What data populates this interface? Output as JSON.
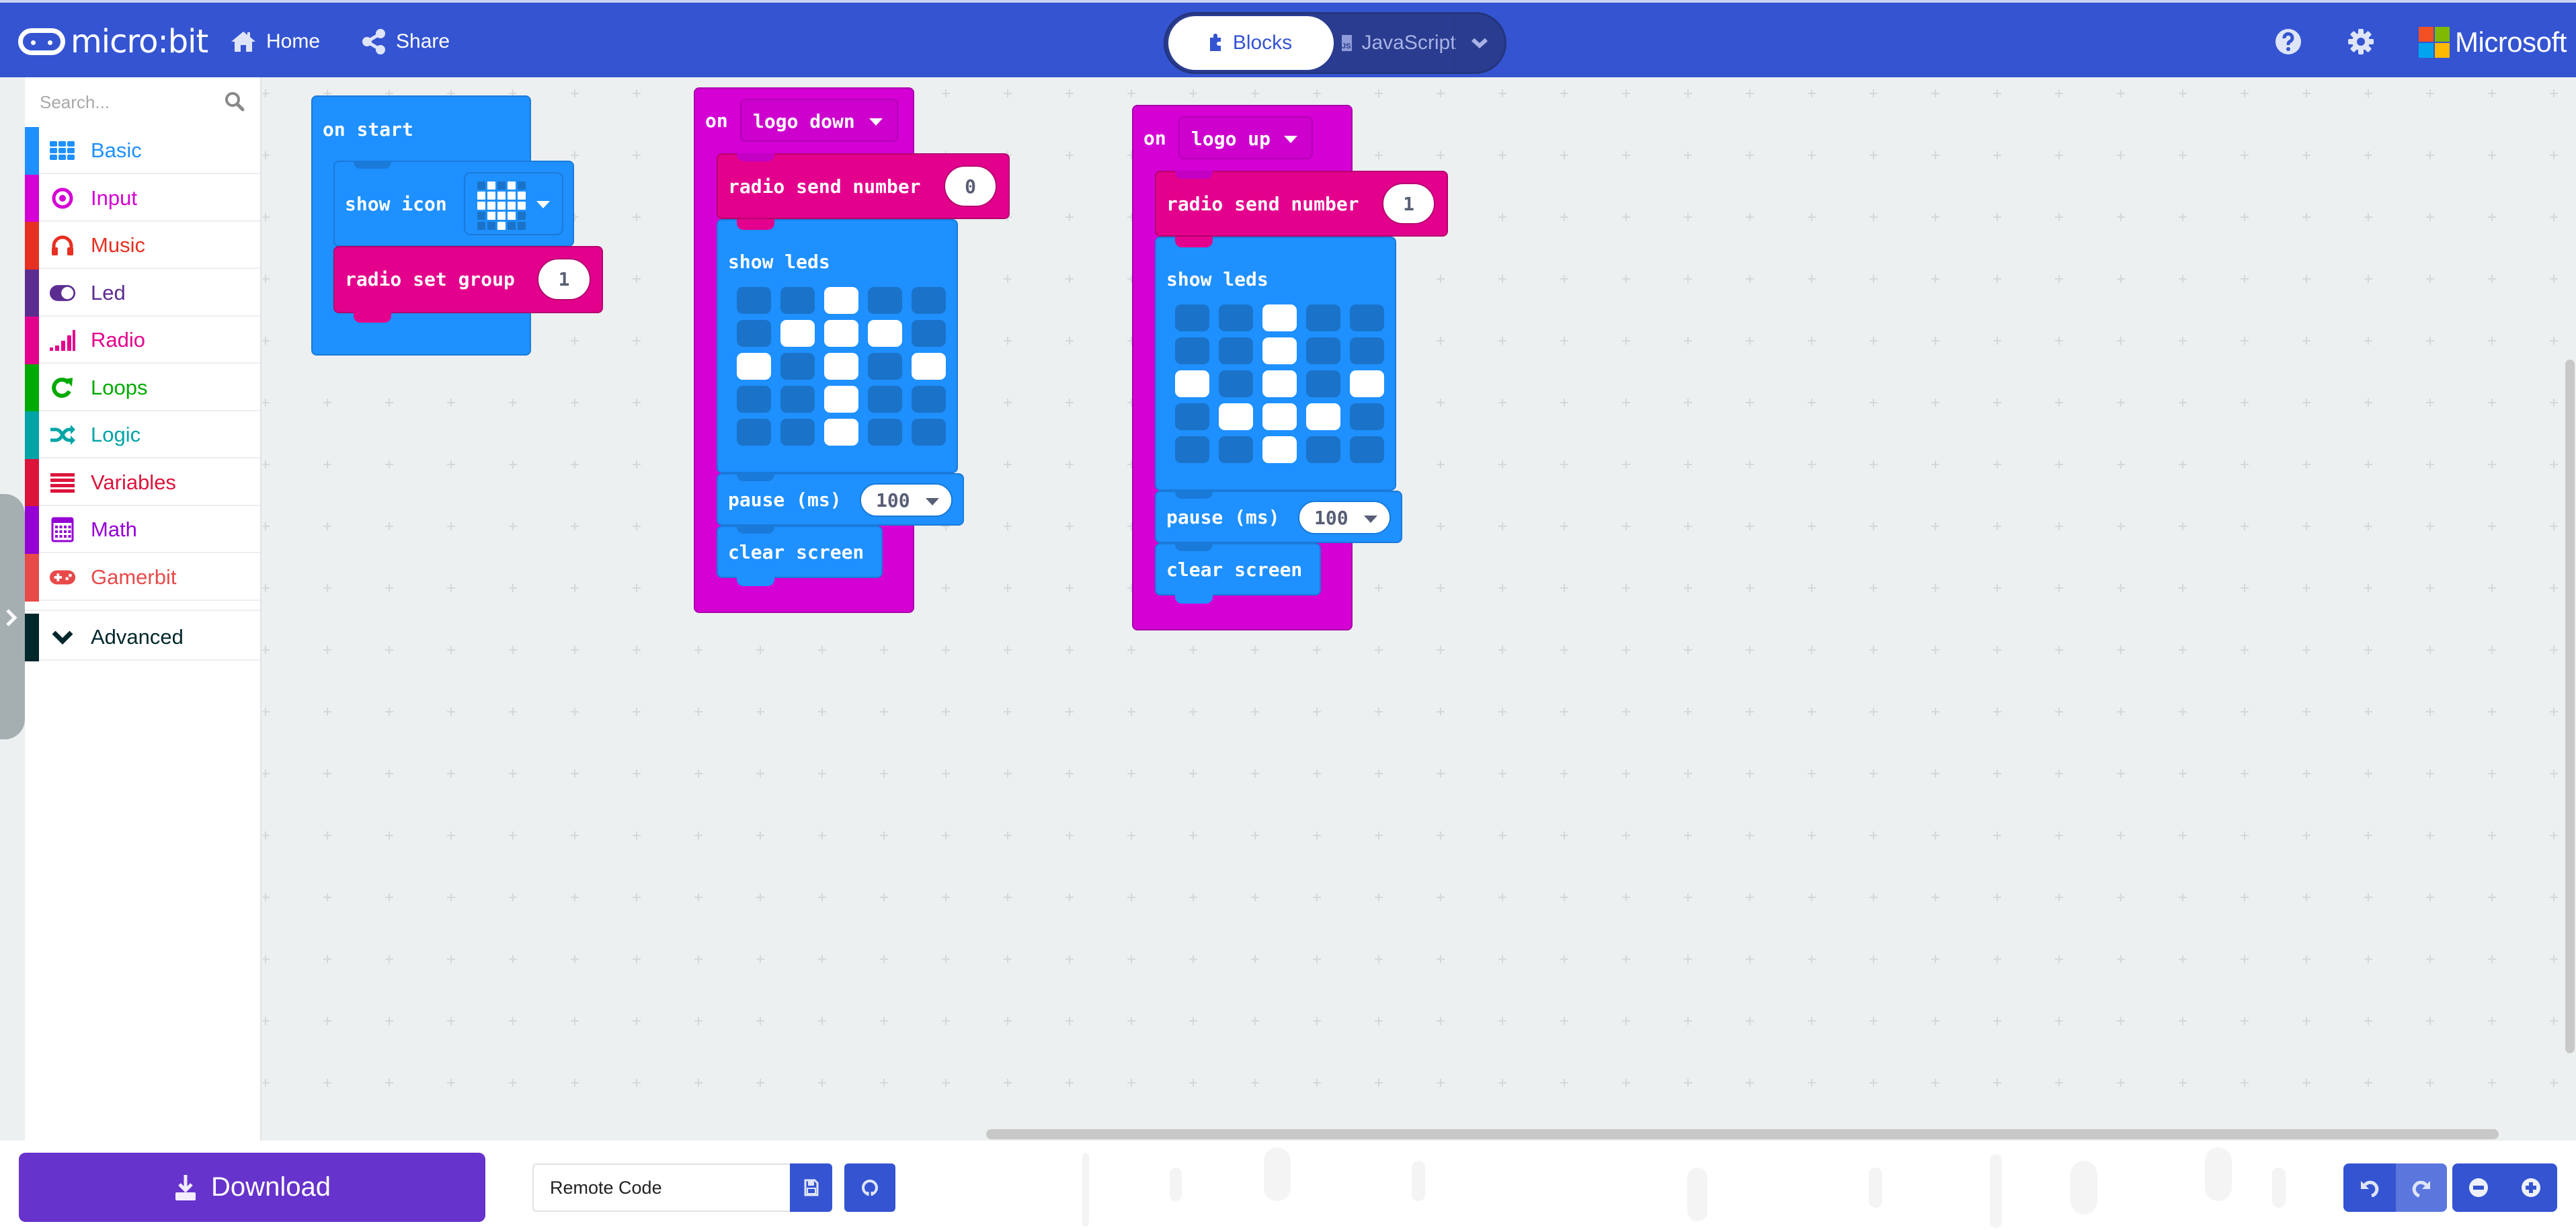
{
  "header": {
    "brand": "micro:bit",
    "home_label": "Home",
    "share_label": "Share",
    "editor_toggle": {
      "blocks_label": "Blocks",
      "javascript_label": "JavaScript",
      "javascript_badge": "JS",
      "active": "Blocks"
    },
    "help_icon": "question-circle-icon",
    "settings_icon": "gear-icon",
    "microsoft_label": "Microsoft",
    "microsoft_colors": [
      "#f25022",
      "#7fba00",
      "#00a4ef",
      "#ffb900"
    ]
  },
  "colors": {
    "header_bg": "#3454d1",
    "download_bg": "#6633cc",
    "basic": "#1e90ff",
    "radio": "#e3008c",
    "input": "#d400d4"
  },
  "sidebar": {
    "search_placeholder": "Search...",
    "categories": [
      {
        "label": "Basic",
        "icon": "grid-icon",
        "color": "#1e90ff"
      },
      {
        "label": "Input",
        "icon": "target-icon",
        "color": "#d400d4"
      },
      {
        "label": "Music",
        "icon": "headphones-icon",
        "color": "#e63022"
      },
      {
        "label": "Led",
        "icon": "toggle-icon",
        "color": "#5c2d91"
      },
      {
        "label": "Radio",
        "icon": "signal-bars-icon",
        "color": "#e3008c"
      },
      {
        "label": "Loops",
        "icon": "refresh-icon",
        "color": "#00aa00"
      },
      {
        "label": "Logic",
        "icon": "shuffle-icon",
        "color": "#00a4a6"
      },
      {
        "label": "Variables",
        "icon": "list-icon",
        "color": "#dc143c"
      },
      {
        "label": "Math",
        "icon": "calculator-icon",
        "color": "#9400d3"
      },
      {
        "label": "Gamerbit",
        "icon": "gamepad-icon",
        "color": "#e84a4a"
      }
    ],
    "advanced": {
      "label": "Advanced",
      "icon": "chevron-down-icon",
      "color": "#00272b"
    }
  },
  "workspace": {
    "on_start": {
      "hat_label": "on start",
      "show_icon_label": "show icon",
      "icon_pattern": [
        [
          0,
          1,
          0,
          1,
          0
        ],
        [
          1,
          1,
          1,
          1,
          1
        ],
        [
          1,
          1,
          1,
          1,
          1
        ],
        [
          0,
          1,
          1,
          1,
          0
        ],
        [
          0,
          0,
          1,
          0,
          0
        ]
      ],
      "radio_set_group_label": "radio set group",
      "radio_group_value": "1"
    },
    "logo_down": {
      "on_label": "on",
      "event": "logo down",
      "send_label": "radio send number",
      "send_value": "0",
      "show_leds_label": "show leds",
      "leds": [
        [
          0,
          0,
          1,
          0,
          0
        ],
        [
          0,
          1,
          1,
          1,
          0
        ],
        [
          1,
          0,
          1,
          0,
          1
        ],
        [
          0,
          0,
          1,
          0,
          0
        ],
        [
          0,
          0,
          1,
          0,
          0
        ]
      ],
      "pause_label": "pause (ms)",
      "pause_value": "100",
      "clear_label": "clear screen"
    },
    "logo_up": {
      "on_label": "on",
      "event": "logo up",
      "send_label": "radio send number",
      "send_value": "1",
      "show_leds_label": "show leds",
      "leds": [
        [
          0,
          0,
          1,
          0,
          0
        ],
        [
          0,
          0,
          1,
          0,
          0
        ],
        [
          1,
          0,
          1,
          0,
          1
        ],
        [
          0,
          1,
          1,
          1,
          0
        ],
        [
          0,
          0,
          1,
          0,
          0
        ]
      ],
      "pause_label": "pause (ms)",
      "pause_value": "100",
      "clear_label": "clear screen"
    }
  },
  "bottombar": {
    "download_label": "Download",
    "project_name": "Remote Code",
    "save_icon": "floppy-disk-icon",
    "github_icon": "github-icon",
    "undo_icon": "undo-icon",
    "redo_icon": "redo-icon",
    "zoom_out_icon": "zoom-out-icon",
    "zoom_in_icon": "zoom-in-icon"
  }
}
